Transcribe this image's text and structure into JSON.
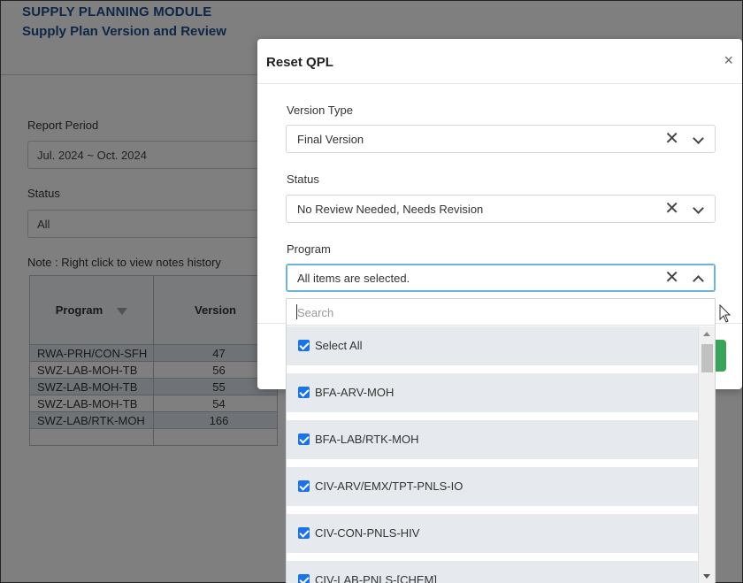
{
  "module": {
    "title": "SUPPLY PLANNING MODULE",
    "subtitle": "Supply Plan Version and Review"
  },
  "background": {
    "report_period_label": "Report Period",
    "report_period_value": "Jul. 2024 ~ Oct. 2024",
    "status_label": "Status",
    "status_value": "All",
    "note": "Note : Right click to view notes history",
    "table": {
      "headers": [
        "Program",
        "Version"
      ],
      "rows": [
        {
          "program": "RWA-PRH/CON-SFH",
          "version": "47"
        },
        {
          "program": "SWZ-LAB-MOH-TB",
          "version": "56"
        },
        {
          "program": "SWZ-LAB-MOH-TB",
          "version": "55"
        },
        {
          "program": "SWZ-LAB-MOH-TB",
          "version": "54"
        },
        {
          "program": "SWZ-LAB/RTK-MOH",
          "version": "166"
        }
      ]
    }
  },
  "modal": {
    "title": "Reset QPL",
    "close_glyph": "×",
    "version_type": {
      "label": "Version Type",
      "value": "Final Version"
    },
    "status": {
      "label": "Status",
      "value": "No Review Needed, Needs Revision"
    },
    "program": {
      "label": "Program",
      "value": "All items are selected."
    },
    "clear_glyph": "✕"
  },
  "dropdown": {
    "search_placeholder": "Search",
    "items": [
      {
        "label": "Select All",
        "checked": true
      },
      {
        "label": "BFA-ARV-MOH",
        "checked": true
      },
      {
        "label": "BFA-LAB/RTK-MOH",
        "checked": true
      },
      {
        "label": "CIV-ARV/EMX/TPT-PNLS-IO",
        "checked": true
      },
      {
        "label": "CIV-CON-PNLS-HIV",
        "checked": true
      },
      {
        "label": "CIV-LAB-PNLS-[CHEM]",
        "checked": true
      }
    ]
  },
  "colors": {
    "module_title": "#1f4e8c",
    "checkbox": "#1a73e8",
    "focus_border": "#6db3d8",
    "confirm_button": "#3aa35a",
    "item_bg": "#e6e9ed"
  }
}
